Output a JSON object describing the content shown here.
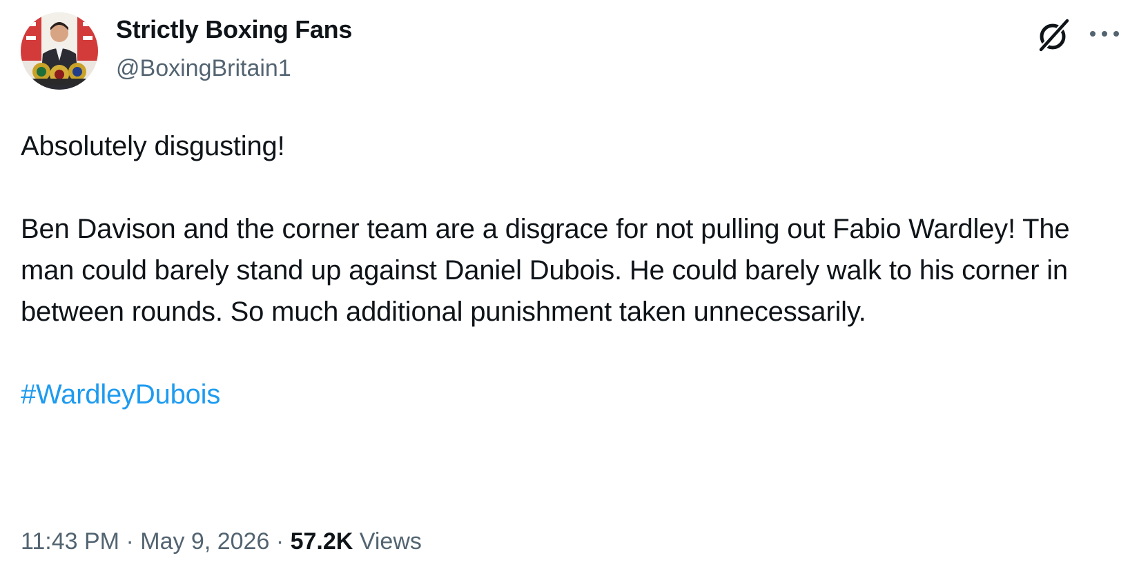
{
  "tweet": {
    "author": {
      "display_name": "Strictly Boxing Fans",
      "handle": "@BoxingBritain1"
    },
    "text": {
      "line1": "Absolutely disgusting!",
      "paragraph2": "Ben Davison and the corner team are a disgrace for not pulling out Fabio Wardley! The man could barely stand up against Daniel Dubois. He could barely walk to his corner in between rounds. So much additional punishment taken unnecessarily.",
      "hashtag": "#WardleyDubois"
    },
    "meta": {
      "time": "11:43 PM",
      "separator": "·",
      "date": "May 9, 2026",
      "views_count": "57.2K",
      "views_label": "Views"
    },
    "icons": {
      "grok": "grok-icon",
      "more": "more-icon"
    },
    "colors": {
      "text_primary": "#0f1419",
      "text_secondary": "#536471",
      "link": "#1d9bf0"
    }
  }
}
